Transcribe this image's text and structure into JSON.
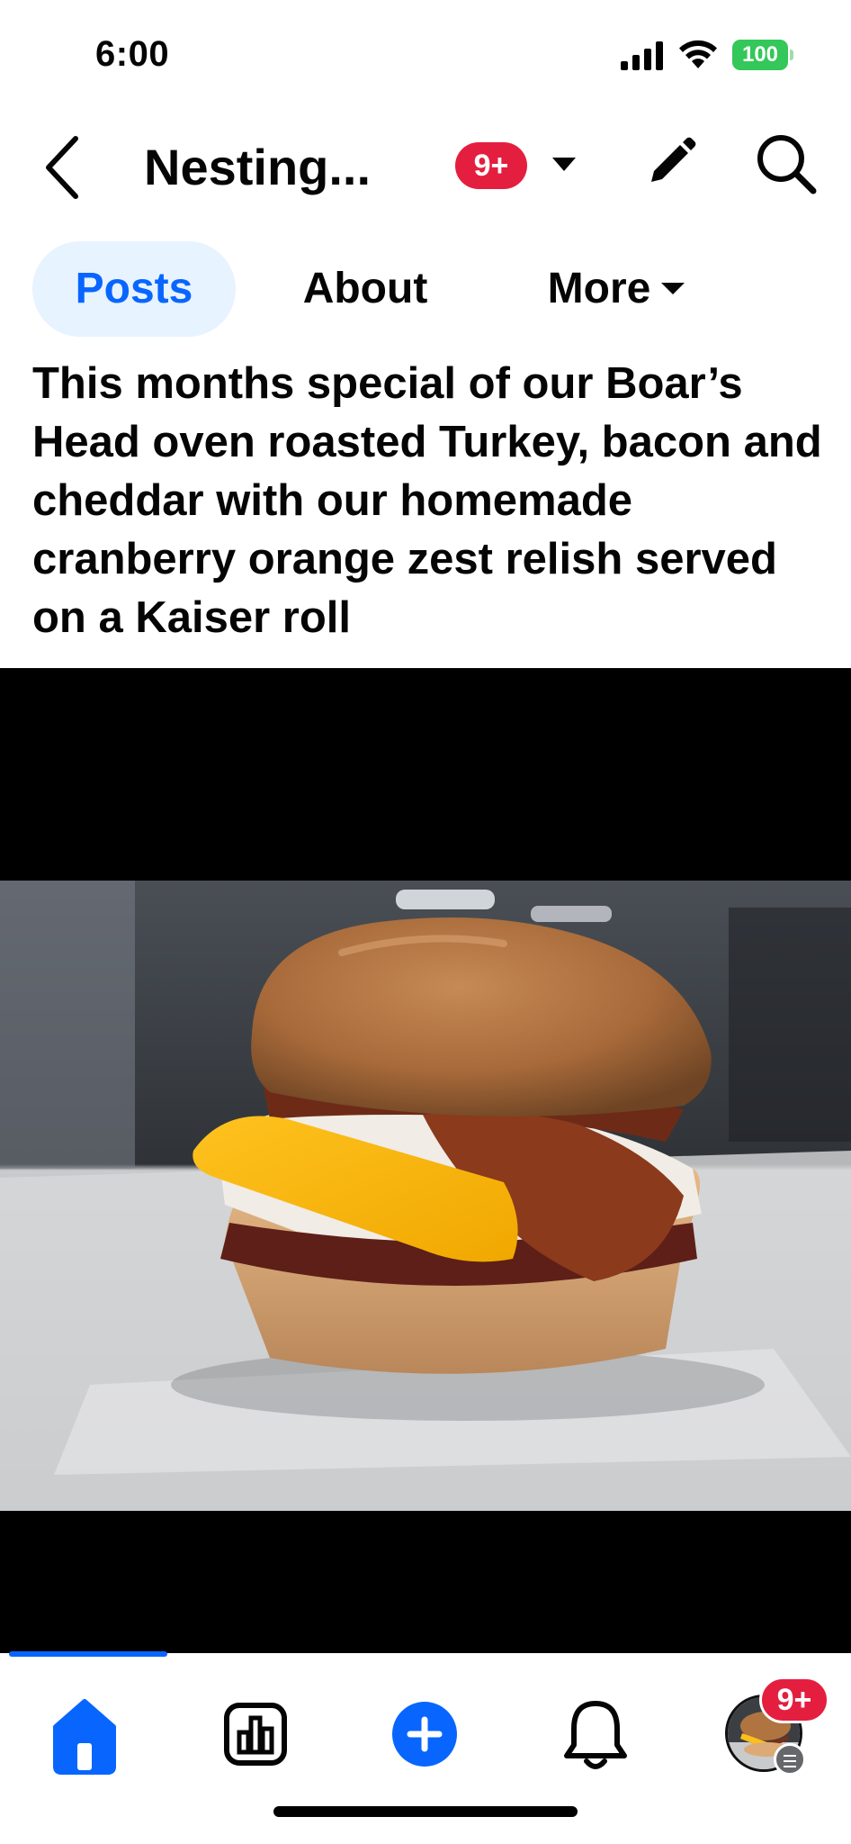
{
  "status_bar": {
    "time": "6:00",
    "battery_level": "100",
    "icons": [
      "signal-icon",
      "wifi-icon",
      "battery-icon"
    ]
  },
  "header": {
    "page_name": "Nesting...",
    "notification_badge": "9+",
    "icons": [
      "back-icon",
      "caret-down-icon",
      "edit-icon",
      "search-icon"
    ]
  },
  "tabs": [
    {
      "label": "Posts",
      "active": true
    },
    {
      "label": "About",
      "active": false
    },
    {
      "label": "More",
      "active": false
    }
  ],
  "post": {
    "text": "This months special of our Boar’s Head oven roasted Turkey, bacon and cheddar with our homemade cranberry orange zest relish served on a Kaiser roll",
    "photo_subject": "turkey-bacon-cheddar-sandwich-photo",
    "video_progress": 0.19
  },
  "bottom_nav": {
    "items": [
      "home-icon",
      "dashboard-icon",
      "create-icon",
      "notifications-icon",
      "profile-avatar"
    ],
    "profile_badge": "9+",
    "active": "home"
  },
  "colors": {
    "accent": "#0866ff",
    "tab_active_bg": "#e7f3ff",
    "badge": "#e41e3f",
    "battery": "#34c759"
  }
}
